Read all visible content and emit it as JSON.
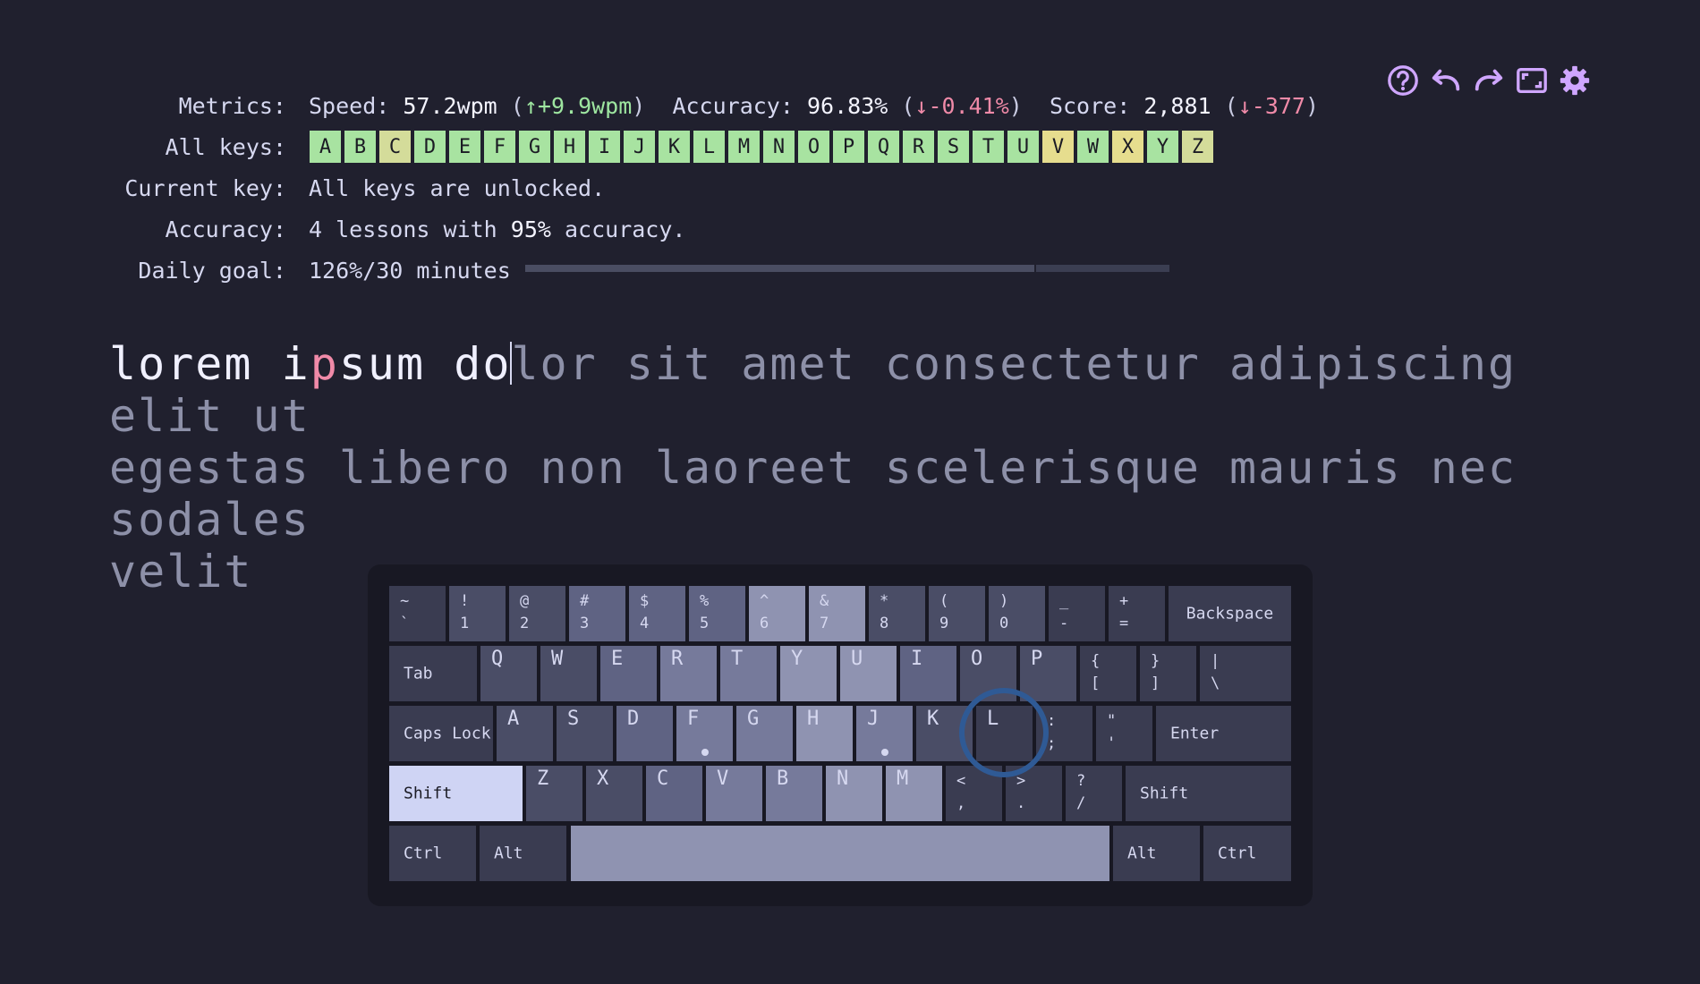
{
  "toolbar": {
    "icons": [
      "help-icon",
      "undo-icon",
      "redo-icon",
      "fullscreen-icon",
      "gear-icon"
    ],
    "icon_color": "#cfa6ff"
  },
  "metrics": {
    "label": "Metrics:",
    "speed_label": "Speed:",
    "speed_value": "57.2wpm",
    "speed_delta": "↑+9.9wpm",
    "accuracy_label": "Accuracy:",
    "accuracy_value": "96.83%",
    "accuracy_delta": "↓-0.41%",
    "score_label": "Score:",
    "score_value": "2,881",
    "score_delta": "↓-377"
  },
  "all_keys": {
    "label": "All keys:",
    "keys": [
      "A",
      "B",
      "C",
      "D",
      "E",
      "F",
      "G",
      "H",
      "I",
      "J",
      "K",
      "L",
      "M",
      "N",
      "O",
      "P",
      "Q",
      "R",
      "S",
      "T",
      "U",
      "V",
      "W",
      "X",
      "Y",
      "Z"
    ],
    "shades": [
      "g",
      "g",
      "y",
      "g",
      "g",
      "g",
      "g",
      "g",
      "g",
      "g",
      "g",
      "g",
      "g",
      "g",
      "g",
      "g",
      "g",
      "g",
      "g",
      "g",
      "g",
      "o",
      "g",
      "o",
      "g",
      "y"
    ]
  },
  "current_key": {
    "label": "Current key:",
    "text": "All keys are unlocked."
  },
  "accuracy_row": {
    "label": "Accuracy:",
    "prefix": "4 lessons with ",
    "highlight": "95%",
    "suffix": " accuracy."
  },
  "daily_goal": {
    "label": "Daily goal:",
    "text": "126%/30 minutes",
    "progress": 0.79
  },
  "lesson_text": {
    "typed_1": "lorem i",
    "error": "p",
    "typed_2": "sum do",
    "remaining_1": "lor sit amet consectetur adipiscing elit ut",
    "line_2": "egestas libero non laoreet scelerisque mauris nec sodales",
    "line_3": "velit"
  },
  "keyboard": {
    "row1": [
      [
        "~",
        "`"
      ],
      [
        "!",
        "1"
      ],
      [
        "@",
        "2"
      ],
      [
        "#",
        "3"
      ],
      [
        "$",
        "4"
      ],
      [
        "%",
        "5"
      ],
      [
        "^",
        "6"
      ],
      [
        "&",
        "7"
      ],
      [
        "*",
        "8"
      ],
      [
        "(",
        "9"
      ],
      [
        ")",
        "0"
      ],
      [
        "_",
        "-"
      ],
      [
        "+",
        "="
      ]
    ],
    "backspace": "Backspace",
    "tab": "Tab",
    "row2": [
      "Q",
      "W",
      "E",
      "R",
      "T",
      "Y",
      "U",
      "I",
      "O",
      "P"
    ],
    "row2_sym": [
      [
        "{",
        "["
      ],
      [
        "}",
        "]"
      ],
      [
        "|",
        "\\"
      ]
    ],
    "caps": "Caps Lock",
    "row3": [
      "A",
      "S",
      "D",
      "F",
      "G",
      "H",
      "J",
      "K",
      "L"
    ],
    "row3_sym": [
      [
        ":",
        ";"
      ],
      [
        "\"",
        "'"
      ]
    ],
    "enter": "Enter",
    "shift": "Shift",
    "row4": [
      "Z",
      "X",
      "C",
      "V",
      "B",
      "N",
      "M"
    ],
    "row4_sym": [
      [
        "<",
        ","
      ],
      [
        ">",
        "."
      ],
      [
        "?",
        "/"
      ]
    ],
    "ctrl": "Ctrl",
    "alt": "Alt"
  }
}
